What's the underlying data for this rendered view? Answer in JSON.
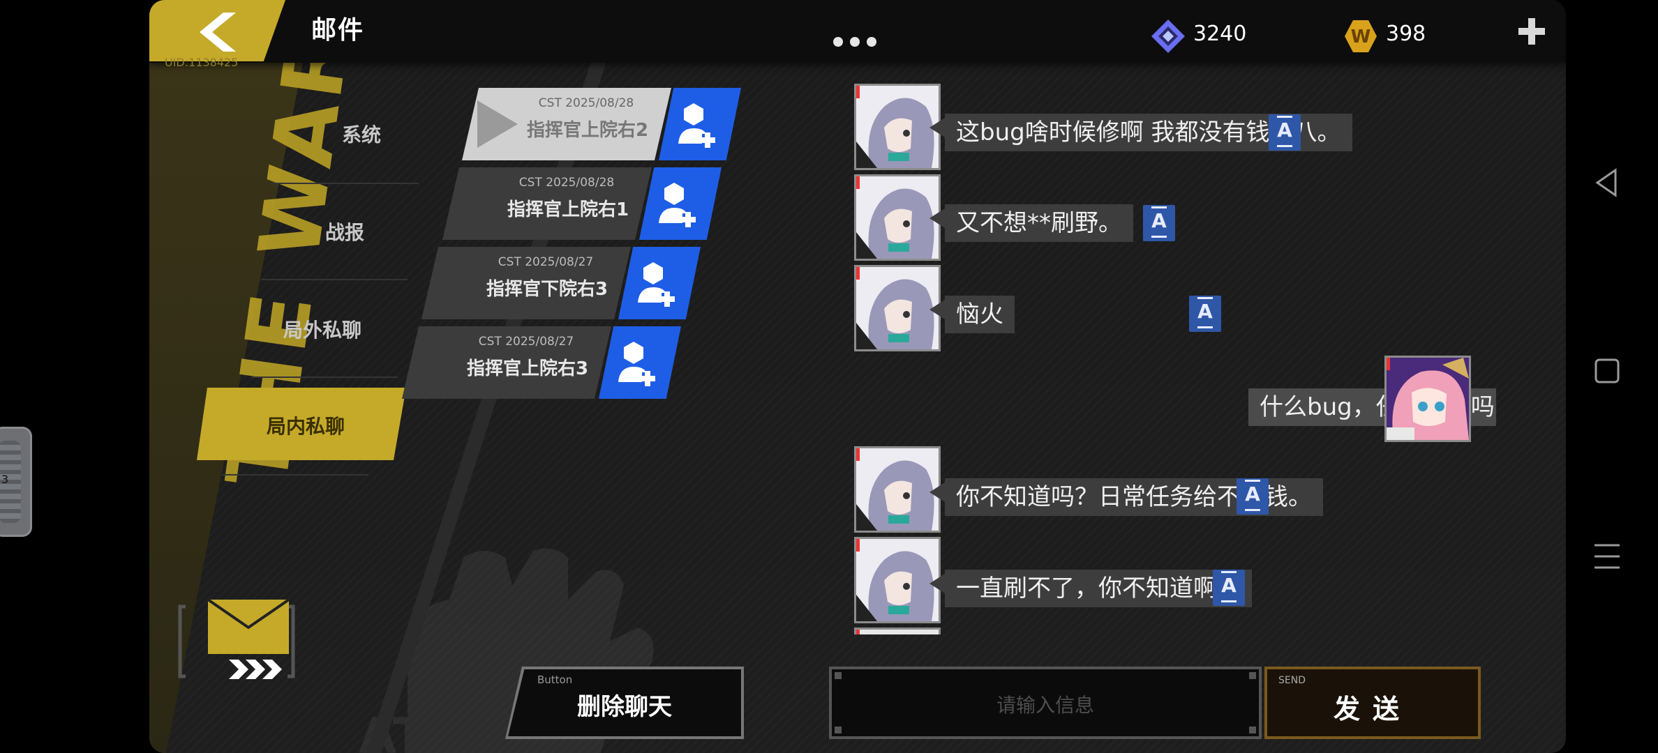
{
  "header": {
    "title": "邮件",
    "uid": "UID:1138425",
    "crystal_amount": "3240",
    "coin_amount": "398",
    "coin_symbol": "W"
  },
  "deco": {
    "text": "THE WAR",
    "fist_text": "ATTI"
  },
  "categories": [
    {
      "label": "系统",
      "active": false
    },
    {
      "label": "战报",
      "active": false
    },
    {
      "label": "局外私聊",
      "active": false
    },
    {
      "label": "局内私聊",
      "active": true
    }
  ],
  "mail_list": [
    {
      "date": "CST 2025/08/28",
      "name": "指挥官上院右2",
      "selected": true
    },
    {
      "date": "CST 2025/08/28",
      "name": "指挥官上院右1",
      "selected": false
    },
    {
      "date": "CST 2025/08/27",
      "name": "指挥官下院右3",
      "selected": false
    },
    {
      "date": "CST 2025/08/27",
      "name": "指挥官上院右3",
      "selected": false
    }
  ],
  "messages": [
    {
      "side": "left",
      "text": "这bug啥时候修啊 我都没有钱升八。"
    },
    {
      "side": "left",
      "text": "又不想**刷野。"
    },
    {
      "side": "left",
      "text": "恼火"
    },
    {
      "side": "right",
      "text": "什么bug，任务没了吗"
    },
    {
      "side": "left",
      "text": "你不知道吗？日常任务给不了钱。"
    },
    {
      "side": "left",
      "text": "一直刷不了，你不知道啊。"
    }
  ],
  "translate_label": "A",
  "bottom": {
    "delete_tag": "Button",
    "delete_label": "删除聊天",
    "input_placeholder": "请输入信息",
    "send_tag": "SEND",
    "send_label": "发送"
  },
  "edge_widget_value": "3",
  "colors": {
    "accent_yellow": "#c5aa2a",
    "add_friend_blue": "#1e5ee6",
    "translate_blue": "#2f57a8"
  }
}
